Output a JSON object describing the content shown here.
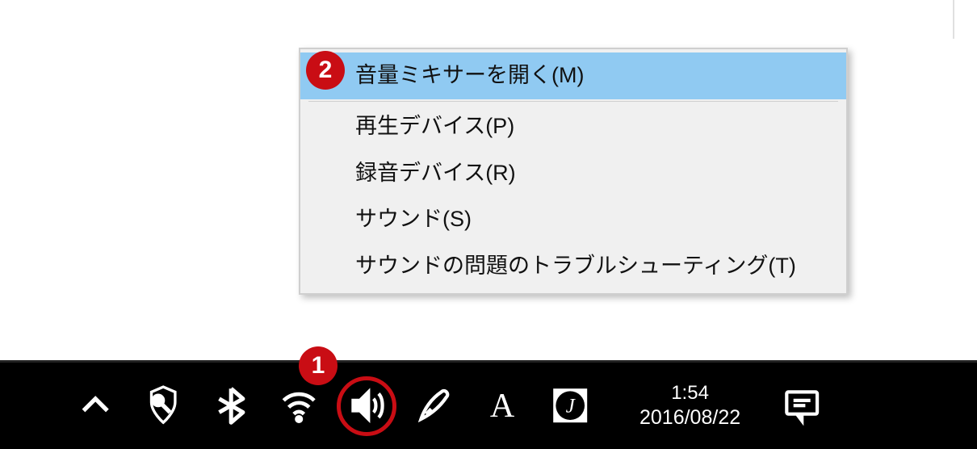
{
  "context_menu": {
    "items": [
      {
        "label": "音量ミキサーを開く(M)",
        "highlighted": true
      },
      {
        "label": "再生デバイス(P)",
        "highlighted": false
      },
      {
        "label": "録音デバイス(R)",
        "highlighted": false
      },
      {
        "label": "サウンド(S)",
        "highlighted": false
      },
      {
        "label": "サウンドの問題のトラブルシューティング(T)",
        "highlighted": false
      }
    ]
  },
  "taskbar": {
    "icons": {
      "chevron": "chevron-up-icon",
      "security": "security-icon",
      "bluetooth": "bluetooth-icon",
      "wifi": "wifi-icon",
      "speaker": "speaker-icon",
      "pen": "pen-icon",
      "ime": "A",
      "circlej": "J",
      "notification": "notification-icon"
    },
    "clock": {
      "time": "1:54",
      "date": "2016/08/22"
    }
  },
  "annotations": {
    "badge1": "1",
    "badge2": "2"
  }
}
